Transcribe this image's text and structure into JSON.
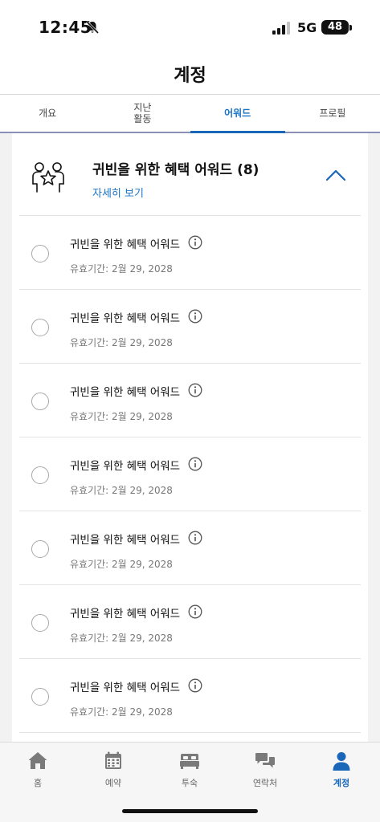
{
  "status": {
    "time": "12:45",
    "network": "5G",
    "battery": "48"
  },
  "header": {
    "title": "계정"
  },
  "tabs": [
    {
      "label": "개요",
      "active": false
    },
    {
      "label": "지난\n활동",
      "active": false
    },
    {
      "label": "어워드",
      "active": true
    },
    {
      "label": "프로필",
      "active": false
    }
  ],
  "section": {
    "title": "귀빈을 위한 혜택 어워드 (8)",
    "link": "자세히 보기",
    "icon": "people-star-icon"
  },
  "items": [
    {
      "title": "귀빈을 위한 혜택 어워드",
      "expiry": "유효기간: 2월 29, 2028"
    },
    {
      "title": "귀빈을 위한 혜택 어워드",
      "expiry": "유효기간: 2월 29, 2028"
    },
    {
      "title": "귀빈을 위한 혜택 어워드",
      "expiry": "유효기간: 2월 29, 2028"
    },
    {
      "title": "귀빈을 위한 혜택 어워드",
      "expiry": "유효기간: 2월 29, 2028"
    },
    {
      "title": "귀빈을 위한 혜택 어워드",
      "expiry": "유효기간: 2월 29, 2028"
    },
    {
      "title": "귀빈을 위한 혜택 어워드",
      "expiry": "유효기간: 2월 29, 2028"
    },
    {
      "title": "귀빈을 위한 혜택 어워드",
      "expiry": "유효기간: 2월 29, 2028"
    }
  ],
  "bottom_nav": [
    {
      "label": "홈",
      "icon": "home-icon",
      "active": false
    },
    {
      "label": "예약",
      "icon": "calendar-icon",
      "active": false
    },
    {
      "label": "투숙",
      "icon": "bed-icon",
      "active": false
    },
    {
      "label": "연락처",
      "icon": "chat-icon",
      "active": false
    },
    {
      "label": "계정",
      "icon": "person-icon",
      "active": true
    }
  ],
  "colors": {
    "accent": "#1a66b8",
    "link": "#1a73c6",
    "background": "#f2f2f2"
  }
}
